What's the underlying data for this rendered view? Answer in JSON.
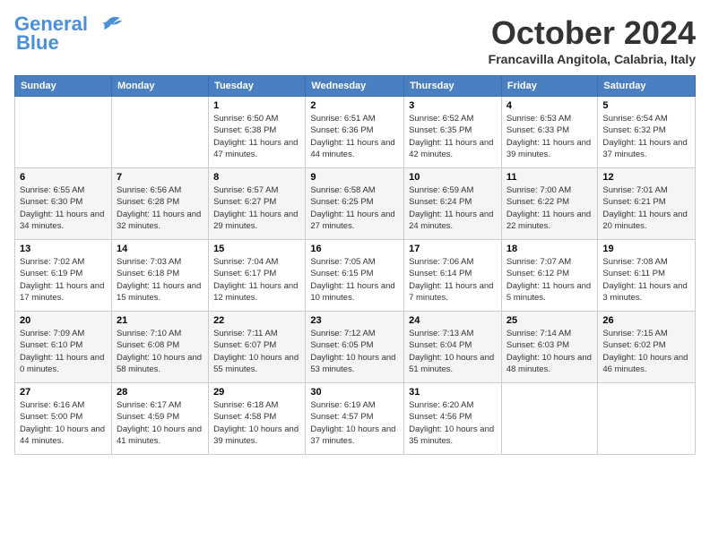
{
  "header": {
    "logo_line1": "General",
    "logo_line2": "Blue",
    "month": "October 2024",
    "location": "Francavilla Angitola, Calabria, Italy"
  },
  "columns": [
    "Sunday",
    "Monday",
    "Tuesday",
    "Wednesday",
    "Thursday",
    "Friday",
    "Saturday"
  ],
  "weeks": [
    [
      {
        "day": "",
        "info": ""
      },
      {
        "day": "",
        "info": ""
      },
      {
        "day": "1",
        "info": "Sunrise: 6:50 AM\nSunset: 6:38 PM\nDaylight: 11 hours and 47 minutes."
      },
      {
        "day": "2",
        "info": "Sunrise: 6:51 AM\nSunset: 6:36 PM\nDaylight: 11 hours and 44 minutes."
      },
      {
        "day": "3",
        "info": "Sunrise: 6:52 AM\nSunset: 6:35 PM\nDaylight: 11 hours and 42 minutes."
      },
      {
        "day": "4",
        "info": "Sunrise: 6:53 AM\nSunset: 6:33 PM\nDaylight: 11 hours and 39 minutes."
      },
      {
        "day": "5",
        "info": "Sunrise: 6:54 AM\nSunset: 6:32 PM\nDaylight: 11 hours and 37 minutes."
      }
    ],
    [
      {
        "day": "6",
        "info": "Sunrise: 6:55 AM\nSunset: 6:30 PM\nDaylight: 11 hours and 34 minutes."
      },
      {
        "day": "7",
        "info": "Sunrise: 6:56 AM\nSunset: 6:28 PM\nDaylight: 11 hours and 32 minutes."
      },
      {
        "day": "8",
        "info": "Sunrise: 6:57 AM\nSunset: 6:27 PM\nDaylight: 11 hours and 29 minutes."
      },
      {
        "day": "9",
        "info": "Sunrise: 6:58 AM\nSunset: 6:25 PM\nDaylight: 11 hours and 27 minutes."
      },
      {
        "day": "10",
        "info": "Sunrise: 6:59 AM\nSunset: 6:24 PM\nDaylight: 11 hours and 24 minutes."
      },
      {
        "day": "11",
        "info": "Sunrise: 7:00 AM\nSunset: 6:22 PM\nDaylight: 11 hours and 22 minutes."
      },
      {
        "day": "12",
        "info": "Sunrise: 7:01 AM\nSunset: 6:21 PM\nDaylight: 11 hours and 20 minutes."
      }
    ],
    [
      {
        "day": "13",
        "info": "Sunrise: 7:02 AM\nSunset: 6:19 PM\nDaylight: 11 hours and 17 minutes."
      },
      {
        "day": "14",
        "info": "Sunrise: 7:03 AM\nSunset: 6:18 PM\nDaylight: 11 hours and 15 minutes."
      },
      {
        "day": "15",
        "info": "Sunrise: 7:04 AM\nSunset: 6:17 PM\nDaylight: 11 hours and 12 minutes."
      },
      {
        "day": "16",
        "info": "Sunrise: 7:05 AM\nSunset: 6:15 PM\nDaylight: 11 hours and 10 minutes."
      },
      {
        "day": "17",
        "info": "Sunrise: 7:06 AM\nSunset: 6:14 PM\nDaylight: 11 hours and 7 minutes."
      },
      {
        "day": "18",
        "info": "Sunrise: 7:07 AM\nSunset: 6:12 PM\nDaylight: 11 hours and 5 minutes."
      },
      {
        "day": "19",
        "info": "Sunrise: 7:08 AM\nSunset: 6:11 PM\nDaylight: 11 hours and 3 minutes."
      }
    ],
    [
      {
        "day": "20",
        "info": "Sunrise: 7:09 AM\nSunset: 6:10 PM\nDaylight: 11 hours and 0 minutes."
      },
      {
        "day": "21",
        "info": "Sunrise: 7:10 AM\nSunset: 6:08 PM\nDaylight: 10 hours and 58 minutes."
      },
      {
        "day": "22",
        "info": "Sunrise: 7:11 AM\nSunset: 6:07 PM\nDaylight: 10 hours and 55 minutes."
      },
      {
        "day": "23",
        "info": "Sunrise: 7:12 AM\nSunset: 6:05 PM\nDaylight: 10 hours and 53 minutes."
      },
      {
        "day": "24",
        "info": "Sunrise: 7:13 AM\nSunset: 6:04 PM\nDaylight: 10 hours and 51 minutes."
      },
      {
        "day": "25",
        "info": "Sunrise: 7:14 AM\nSunset: 6:03 PM\nDaylight: 10 hours and 48 minutes."
      },
      {
        "day": "26",
        "info": "Sunrise: 7:15 AM\nSunset: 6:02 PM\nDaylight: 10 hours and 46 minutes."
      }
    ],
    [
      {
        "day": "27",
        "info": "Sunrise: 6:16 AM\nSunset: 5:00 PM\nDaylight: 10 hours and 44 minutes."
      },
      {
        "day": "28",
        "info": "Sunrise: 6:17 AM\nSunset: 4:59 PM\nDaylight: 10 hours and 41 minutes."
      },
      {
        "day": "29",
        "info": "Sunrise: 6:18 AM\nSunset: 4:58 PM\nDaylight: 10 hours and 39 minutes."
      },
      {
        "day": "30",
        "info": "Sunrise: 6:19 AM\nSunset: 4:57 PM\nDaylight: 10 hours and 37 minutes."
      },
      {
        "day": "31",
        "info": "Sunrise: 6:20 AM\nSunset: 4:56 PM\nDaylight: 10 hours and 35 minutes."
      },
      {
        "day": "",
        "info": ""
      },
      {
        "day": "",
        "info": ""
      }
    ]
  ]
}
